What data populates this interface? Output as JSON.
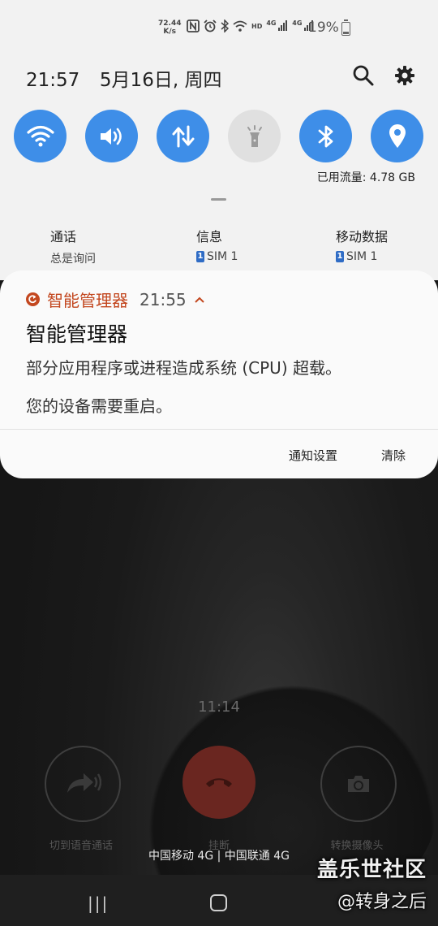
{
  "status_bar": {
    "net_speed_value": "72.44",
    "net_speed_unit": "K/s",
    "hd_label": "HD",
    "lte1": "4G",
    "lte2": "4G",
    "battery": "19%"
  },
  "header": {
    "time": "21:57",
    "date": "5月16日, 周四"
  },
  "quick_settings": {
    "tiles": [
      {
        "name": "wifi",
        "state": "on"
      },
      {
        "name": "sound",
        "state": "on"
      },
      {
        "name": "mobile-data",
        "state": "on"
      },
      {
        "name": "flashlight",
        "state": "off"
      },
      {
        "name": "bluetooth",
        "state": "on"
      },
      {
        "name": "location",
        "state": "on"
      }
    ],
    "data_usage": "已用流量: 4.78 GB"
  },
  "sim_settings": [
    {
      "title": "通话",
      "value": "总是询问",
      "badge": ""
    },
    {
      "title": "信息",
      "value": "SIM 1",
      "badge": "1"
    },
    {
      "title": "移动数据",
      "value": "SIM 1",
      "badge": "1"
    }
  ],
  "notification": {
    "app_name": "智能管理器",
    "time": "21:55",
    "title": "智能管理器",
    "body_line1": "部分应用程序或进程造成系统 (CPU) 超载。",
    "body_line2": "您的设备需要重启。",
    "action_settings": "通知设置",
    "action_clear": "清除",
    "accent_color": "#c3471f"
  },
  "call_screen": {
    "duration": "11:14",
    "voice_label": "切到语音通话",
    "end_label": "挂断",
    "camera_label": "转换摄像头",
    "carriers": "中国移动 4G | 中国联通 4G"
  },
  "watermark": {
    "line1": "盖乐世社区",
    "line2": "@转身之后"
  },
  "colors": {
    "tile_on": "#3e8ee8",
    "tile_off": "#e0e0e0",
    "shade_bg": "#f2f2f2"
  }
}
